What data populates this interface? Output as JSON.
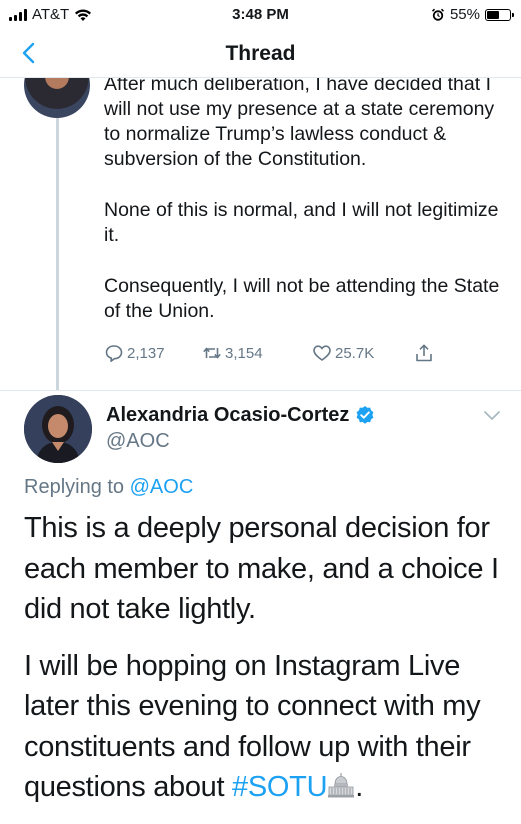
{
  "status_bar": {
    "carrier": "AT&T",
    "time": "3:48 PM",
    "battery": "55%",
    "battery_level": 0.55
  },
  "nav": {
    "title": "Thread",
    "back_icon": "chevron-left-icon"
  },
  "previous_tweet": {
    "paragraphs": [
      "After much deliberation, I have decided that I will not use my presence at a state ceremony to normalize Trump’s lawless conduct & subversion of the Constitution.",
      "None of this is normal, and I will not legitimize it.",
      "Consequently, I will not be attending the State of the Union."
    ],
    "actions": {
      "replies": "2,137",
      "retweets": "3,154",
      "likes": "25.7K"
    }
  },
  "tweet": {
    "author_name": "Alexandria Ocasio-Cortez",
    "handle": "@AOC",
    "replying_prefix": "Replying to",
    "replying_to": "@AOC",
    "paragraph1": "This is a deeply personal decision for each member to make, and a choice I did not take lightly.",
    "paragraph2_before": "I will be hopping on Instagram Live later this evening to connect with my constituents and follow up with their questions about",
    "hashtag": "#SOTU",
    "paragraph2_end": "."
  },
  "colors": {
    "link": "#1da1f2",
    "secondary_text": "#657786",
    "divider": "#e1e8ed"
  }
}
